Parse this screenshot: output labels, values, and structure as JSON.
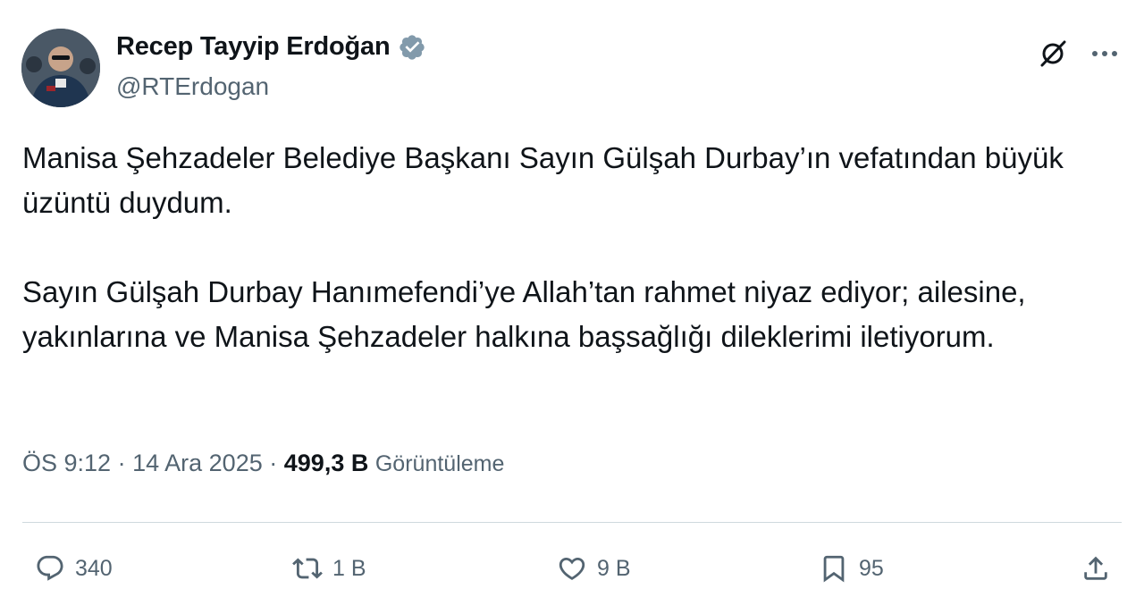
{
  "author": {
    "display_name": "Recep Tayyip Erdoğan",
    "handle": "@RTErdogan",
    "verified_color": "#829aab"
  },
  "header_actions": {
    "grok_icon": "grok-slash-icon",
    "more_icon": "more-dots-icon"
  },
  "tweet": {
    "paragraphs": [
      "Manisa Şehzadeler Belediye Başkanı Sayın Gülşah Durbay’ın vefatından büyük üzüntü duydum.",
      "Sayın Gülşah Durbay Hanımefendi’ye Allah’tan rahmet niyaz ediyor; ailesine, yakınlarına ve Manisa Şehzadeler halkına başsağlığı dileklerimi iletiyorum."
    ],
    "time": "ÖS 9:12",
    "separator": "·",
    "date": "14 Ara 2025",
    "views_count": "499,3 B",
    "views_label": "Görüntüleme"
  },
  "actions": {
    "reply_count": "340",
    "retweet_count": "1 B",
    "like_count": "9 B",
    "bookmark_count": "95"
  },
  "colors": {
    "text_primary": "#0f1419",
    "text_secondary": "#536471",
    "divider": "#cfd9de"
  }
}
